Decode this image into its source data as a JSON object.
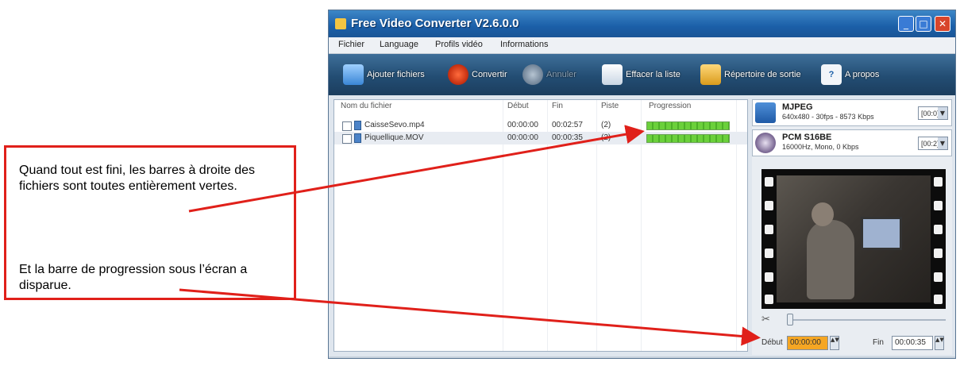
{
  "window": {
    "title": "Free Video Converter V2.6.0.0",
    "minimize_glyph": "_",
    "maximize_glyph": "□",
    "close_glyph": "✕"
  },
  "menu": [
    "Fichier",
    "Language",
    "Profils vidéo",
    "Informations"
  ],
  "toolbar": {
    "add_files": "Ajouter fichiers",
    "convert": "Convertir",
    "cancel": "Annuler",
    "clear_list": "Effacer la liste",
    "output_folder": "Répertoire de sortie",
    "about": "A propos"
  },
  "file_list": {
    "headers": {
      "name": "Nom du fichier",
      "start": "Début",
      "end": "Fin",
      "pista": "Piste",
      "progress": "Progression"
    },
    "rows": [
      {
        "name": "CaisseSevo.mp4",
        "start": "00:00:00",
        "end": "00:02:57",
        "track": "(2)",
        "progress": 1.0
      },
      {
        "name": "Piquellique.MOV",
        "start": "00:00:00",
        "end": "00:00:35",
        "track": "(2)",
        "progress": 1.0
      }
    ]
  },
  "video_codec": {
    "name": "MJPEG",
    "info": "640x480 - 30fps - 8573 Kbps",
    "select": "[00:0]"
  },
  "audio_codec": {
    "name": "PCM S16BE",
    "info": "16000Hz, Mono, 0 Kbps",
    "select": "[00:2]"
  },
  "trim": {
    "scissors_glyph": "✂",
    "start_label": "Début",
    "start_value": "00:00:00",
    "end_label": "Fin",
    "end_value": "00:00:35",
    "spin_glyphs": "▲▼"
  },
  "annotations": {
    "text1": "Quand tout est fini, les barres à droite des fichiers sont toutes entièrement vertes.",
    "text2": "Et la barre de progression sous l’écran a disparue."
  },
  "colors": {
    "annotation_red": "#e0201a",
    "progress_green": "#6bd03b",
    "start_highlight": "#f5a623"
  }
}
